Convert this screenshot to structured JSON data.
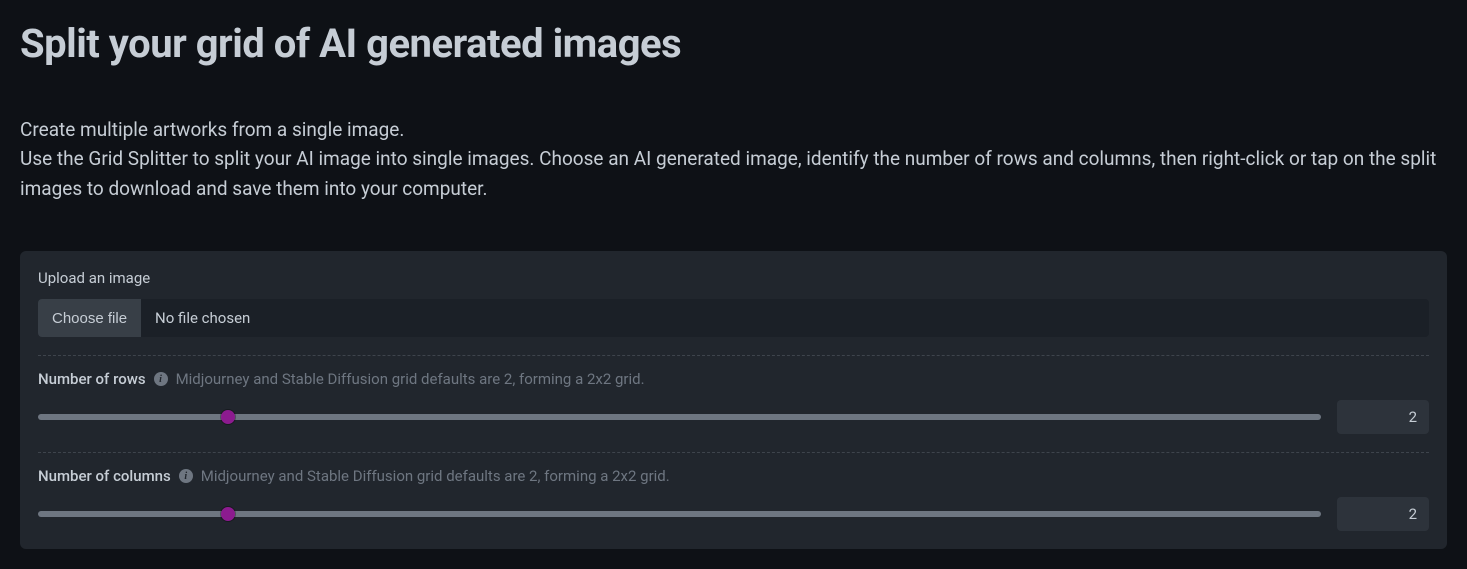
{
  "title": "Split your grid of AI generated images",
  "intro_line1": "Create multiple artworks from a single image.",
  "intro_line2": "Use the Grid Splitter to split your AI image into single images. Choose an AI generated image, identify the number of rows and columns, then right-click or tap on the split images to download and save them into your computer.",
  "upload": {
    "label": "Upload an image",
    "choose_button": "Choose file",
    "status": "No file chosen"
  },
  "rows": {
    "label": "Number of rows",
    "hint": "Midjourney and Stable Diffusion grid defaults are 2, forming a 2x2 grid.",
    "value": "2",
    "thumb_left": "14.8%"
  },
  "cols": {
    "label": "Number of columns",
    "hint": "Midjourney and Stable Diffusion grid defaults are 2, forming a 2x2 grid.",
    "value": "2",
    "thumb_left": "14.8%"
  },
  "info_glyph": "i"
}
